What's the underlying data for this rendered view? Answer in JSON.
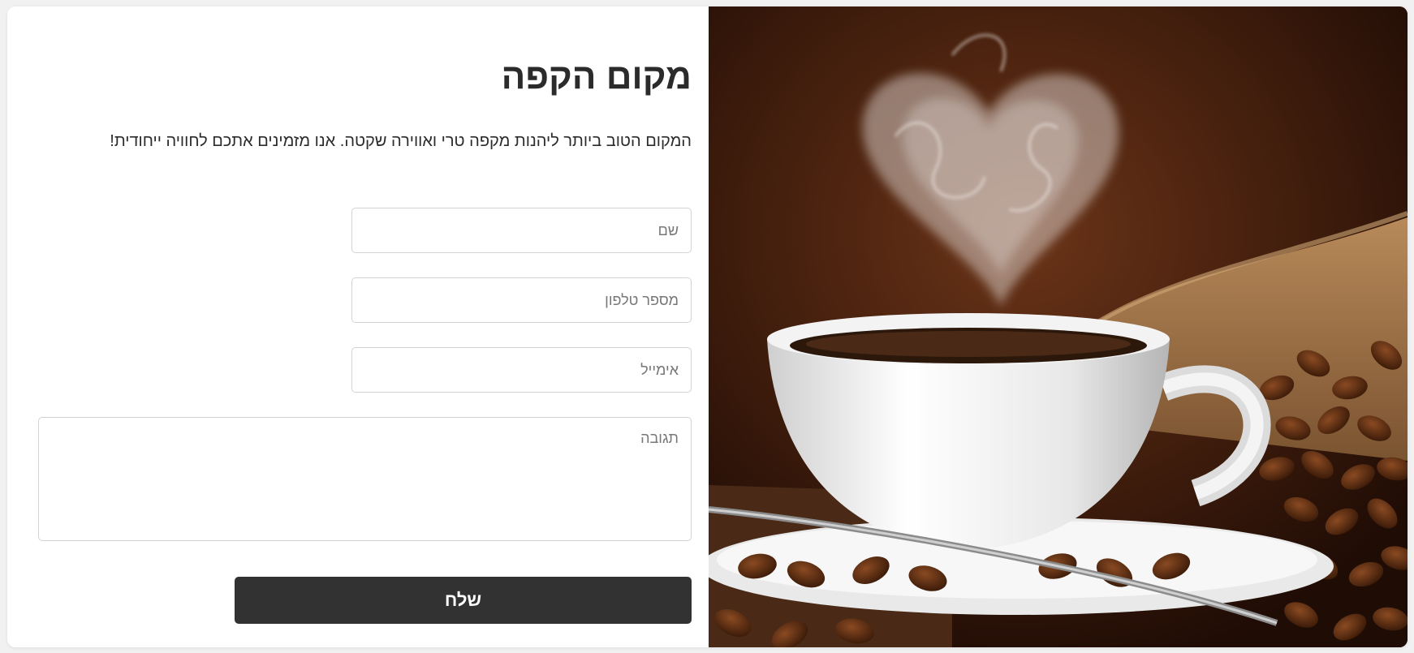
{
  "page": {
    "title": "מקום הקפה",
    "description": "המקום הטוב ביותר ליהנות מקפה טרי ואווירה שקטה. אנו מזמינים אתכם לחוויה ייחודית!"
  },
  "form": {
    "name_placeholder": "שם",
    "phone_placeholder": "מספר טלפון",
    "email_placeholder": "אימייל",
    "feedback_placeholder": "תגובה",
    "submit_label": "שלח"
  },
  "image": {
    "subject": "coffee-cup-with-heart-steam-and-beans"
  },
  "colors": {
    "button_bg": "#323232",
    "text": "#2b2b2b",
    "border": "#d3d3d3"
  }
}
